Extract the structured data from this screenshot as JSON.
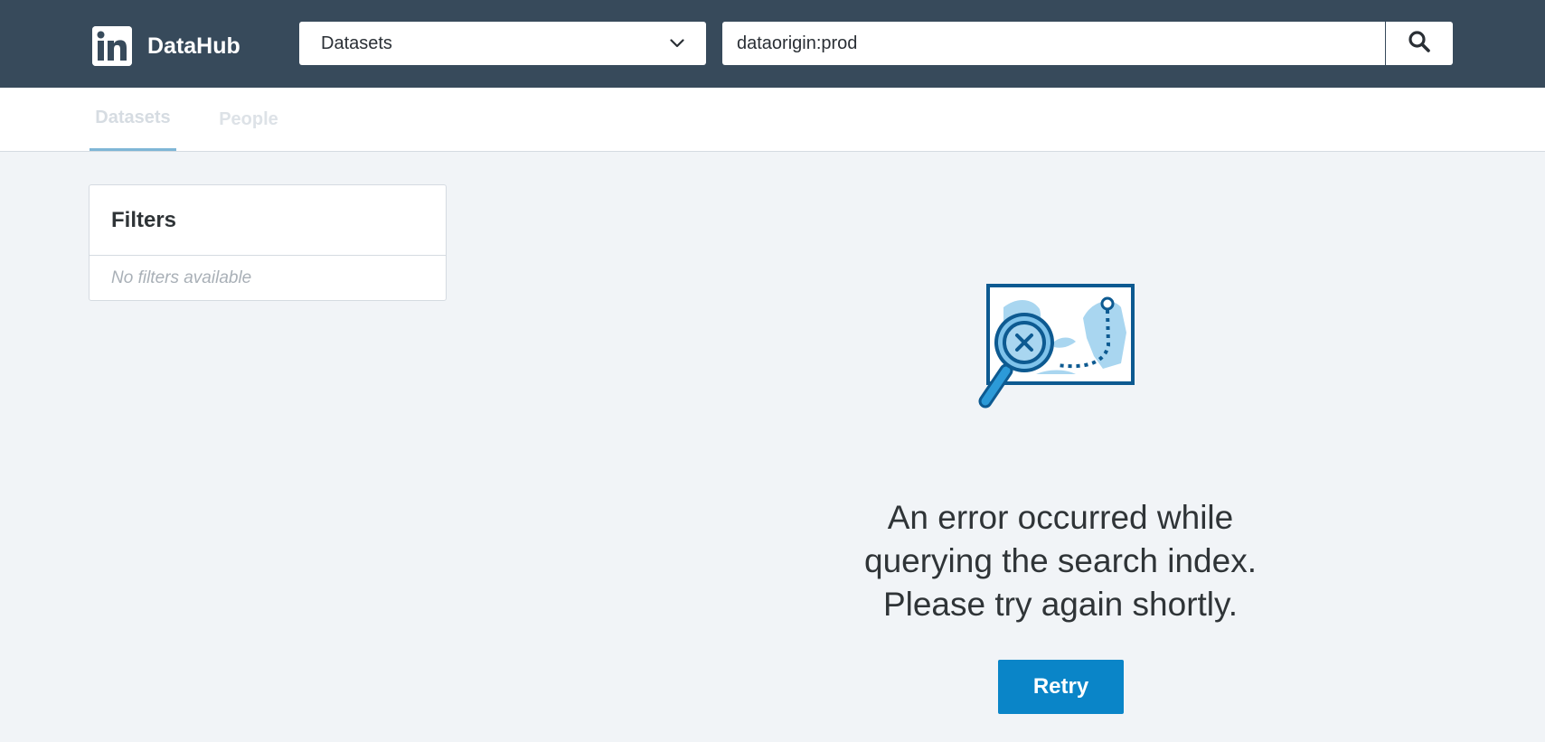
{
  "header": {
    "brand_name": "DataHub",
    "logo_icon": "linkedin-logo-icon",
    "category_select": {
      "value": "Datasets",
      "icon": "chevron-down-icon"
    },
    "search": {
      "value": "dataorigin:prod",
      "icon": "search-icon"
    }
  },
  "tabs": [
    {
      "label": "Datasets",
      "active": true
    },
    {
      "label": "People",
      "active": false
    }
  ],
  "filters": {
    "title": "Filters",
    "empty_text": "No filters available"
  },
  "error": {
    "illustration_icon": "map-search-error-icon",
    "line1": "An error occurred while",
    "line2": "querying the search index.",
    "line3": "Please try again shortly.",
    "retry_label": "Retry"
  },
  "colors": {
    "navbar": "#374a5b",
    "accent": "#0a85c8",
    "page_background": "#f1f4f7"
  }
}
